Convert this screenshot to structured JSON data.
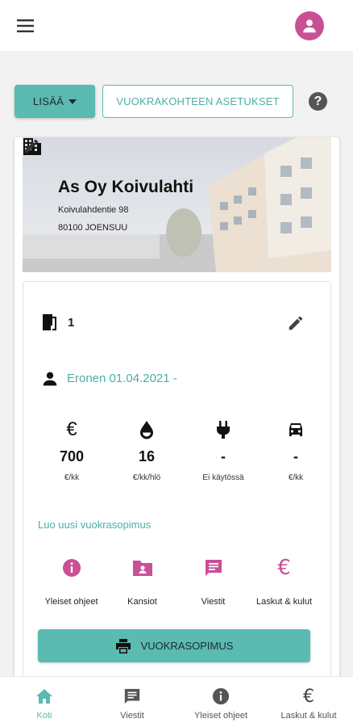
{
  "colors": {
    "accent": "#5bbab1",
    "brand_pink": "#c94f96",
    "text_dark": "#222222"
  },
  "header": {
    "menu_icon": "hamburger-menu-icon",
    "avatar_icon": "account-icon"
  },
  "actions": {
    "lisaa_label": "LISÄÄ",
    "asetukset_label": "VUOKRAKOHTEEN ASETUKSET",
    "help_icon": "help-icon"
  },
  "property": {
    "name": "As Oy Koivulahti",
    "street": "Koivulahdentie 98",
    "city": "80100 JOENSUU"
  },
  "unit": {
    "number": "1",
    "tenant": "Eronen 01.04.2021 -"
  },
  "stats": [
    {
      "symbol": "€",
      "value": "700",
      "unit": "€/kk"
    },
    {
      "symbol": "water-drop-icon",
      "value": "16",
      "unit": "€/kk/hlö"
    },
    {
      "symbol": "plug-icon",
      "value": "-",
      "unit": "Ei käytössä"
    },
    {
      "symbol": "car-icon",
      "value": "-",
      "unit": "€/kk"
    }
  ],
  "new_contract_link": "Luo uusi vuokrasopimus",
  "shortcuts": [
    {
      "label": "Yleiset ohjeet",
      "icon": "info-icon"
    },
    {
      "label": "Kansiot",
      "icon": "folder-person-icon"
    },
    {
      "label": "Viestit",
      "icon": "message-icon"
    },
    {
      "label": "Laskut & kulut",
      "icon": "euro-icon"
    }
  ],
  "contract_button_label": "VUOKRASOPIMUS",
  "bottom_nav": [
    {
      "label": "Koti",
      "icon": "home-icon",
      "active": true
    },
    {
      "label": "Viestit",
      "icon": "message-icon",
      "active": false
    },
    {
      "label": "Yleiset ohjeet",
      "icon": "info-icon",
      "active": false
    },
    {
      "label": "Laskut & kulut",
      "icon": "euro-icon",
      "active": false
    }
  ]
}
